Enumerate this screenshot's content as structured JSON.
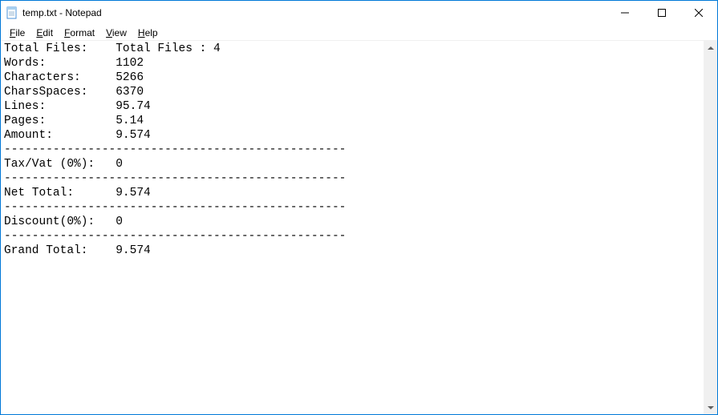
{
  "window": {
    "title": "temp.txt - Notepad"
  },
  "menu": {
    "file": "File",
    "edit": "Edit",
    "format": "Format",
    "view": "View",
    "help": "Help"
  },
  "text": {
    "rows": [
      {
        "label": "Total Files:",
        "value": "Total Files : 4"
      },
      {
        "label": "Words:",
        "value": "1102"
      },
      {
        "label": "Characters:",
        "value": "5266"
      },
      {
        "label": "CharsSpaces:",
        "value": "6370"
      },
      {
        "label": "Lines:",
        "value": "95.74"
      },
      {
        "label": "Pages:",
        "value": "5.14"
      },
      {
        "label": "Amount:",
        "value": "9.574"
      }
    ],
    "separator": "-------------------------------------------------",
    "tax": {
      "label": "Tax/Vat (0%):",
      "value": "0"
    },
    "net": {
      "label": "Net Total:",
      "value": "9.574"
    },
    "discount": {
      "label": "Discount(0%):",
      "value": "0"
    },
    "grand": {
      "label": "Grand Total:",
      "value": "9.574"
    }
  }
}
